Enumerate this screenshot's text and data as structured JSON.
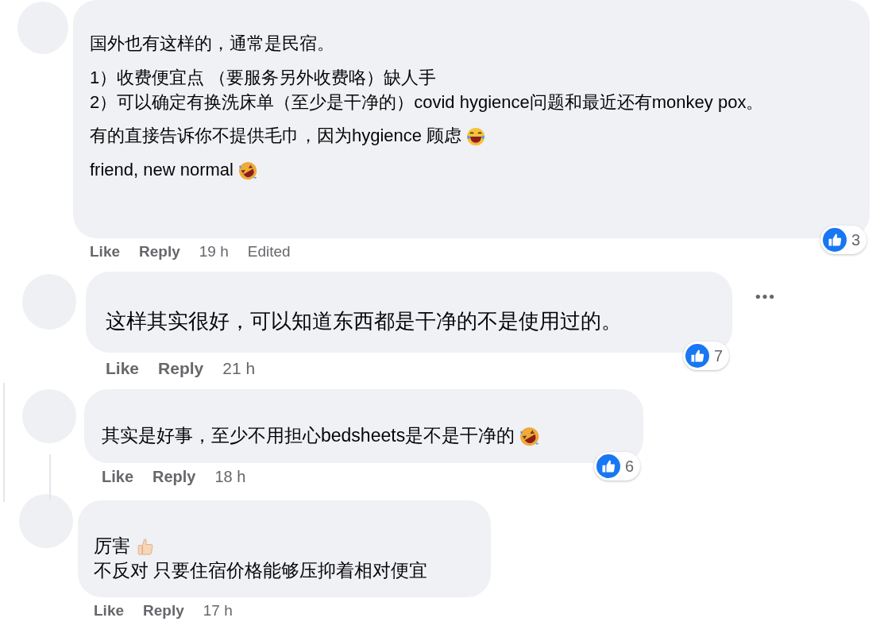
{
  "comments": [
    {
      "paragraphs": [
        {
          "lines": [
            {
              "text": "国外也有这样的，通常是民宿。"
            }
          ]
        },
        {
          "lines": [
            {
              "text": "1）收费便宜点 （要服务另外收费咯）缺人手"
            },
            {
              "text": "2）可以确定有换洗床单（至少是干净的）covid hygience问题和最近还有monkey pox。"
            }
          ]
        },
        {
          "lines": [
            {
              "text": "有的直接告诉你不提供毛巾，因为hygience 顾虑",
              "kind": "tears_of_joy"
            }
          ]
        },
        {
          "lines": [
            {
              "text": "friend, new normal",
              "kind": "rolling_laugh"
            }
          ]
        }
      ],
      "reaction_count": "3",
      "like": "Like",
      "reply": "Reply",
      "time": "19 h",
      "edited_label": "Edited",
      "more_menu": false
    },
    {
      "paragraphs": [
        {
          "lines": [
            {
              "text": "这样其实很好，可以知道东西都是干净的不是使用过的。"
            }
          ]
        }
      ],
      "reaction_count": "7",
      "like": "Like",
      "reply": "Reply",
      "time": "21 h",
      "more_menu": true
    },
    {
      "paragraphs": [
        {
          "lines": [
            {
              "text": "其实是好事，至少不用担心bedsheets是不是干净的",
              "kind": "rolling_laugh"
            }
          ]
        }
      ],
      "reaction_count": "6",
      "like": "Like",
      "reply": "Reply",
      "time": "18 h",
      "more_menu": false
    },
    {
      "paragraphs": [
        {
          "lines": [
            {
              "text": "厉害",
              "kind": "thumbs_up"
            },
            {
              "text": "不反对 只要住宿价格能够压抑着相对便宜"
            }
          ]
        }
      ],
      "like": "Like",
      "reply": "Reply",
      "time": "17 h",
      "more_menu": false
    }
  ]
}
